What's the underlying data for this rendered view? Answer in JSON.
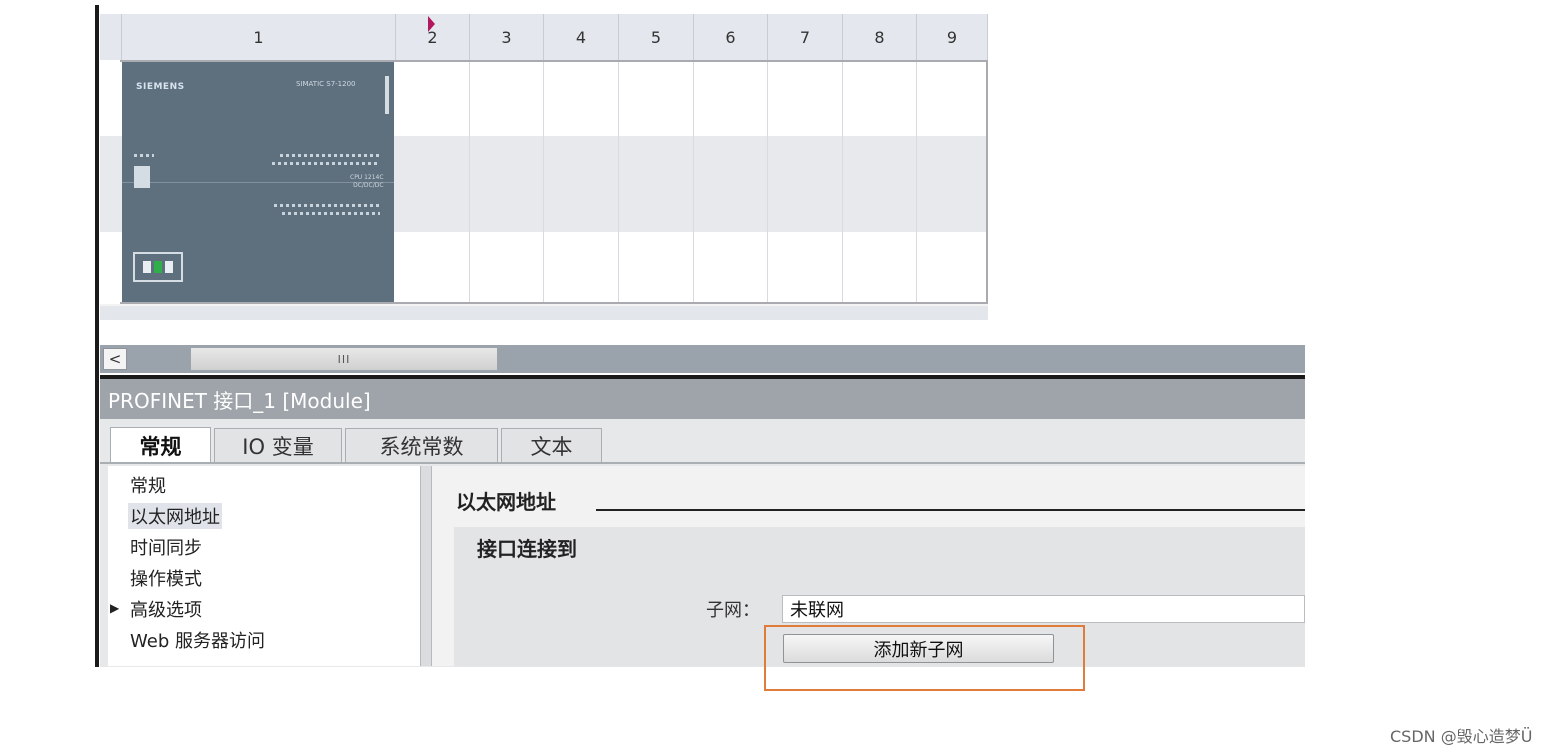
{
  "rack": {
    "slots": [
      "1",
      "2",
      "3",
      "4",
      "5",
      "6",
      "7",
      "8",
      "9"
    ],
    "cpu": {
      "brand": "SIEMENS",
      "model": "SIMATIC S7-1200",
      "type_line1": "CPU 1214C",
      "type_line2": "DC/DC/DC"
    }
  },
  "scrollbar": {
    "left_arrow": "<",
    "thumb_grip": "III"
  },
  "inspector": {
    "title": "PROFINET 接口_1 [Module]",
    "tabs": [
      "常规",
      "IO 变量",
      "系统常数",
      "文本"
    ],
    "active_tab": "常规",
    "nav": [
      "常规",
      "以太网地址",
      "时间同步",
      "操作模式",
      "高级选项",
      "Web 服务器访问"
    ],
    "nav_selected": "以太网地址",
    "section_title": "以太网地址",
    "group_title": "接口连接到",
    "subnet_label": "子网：",
    "subnet_value": "未联网",
    "add_subnet_button": "添加新子网"
  },
  "watermark": "CSDN @毁心造梦Ü",
  "colors": {
    "highlight": "#e07b3c",
    "cpu_body": "#5e6f7d",
    "header_bg": "#9ea4aa"
  }
}
